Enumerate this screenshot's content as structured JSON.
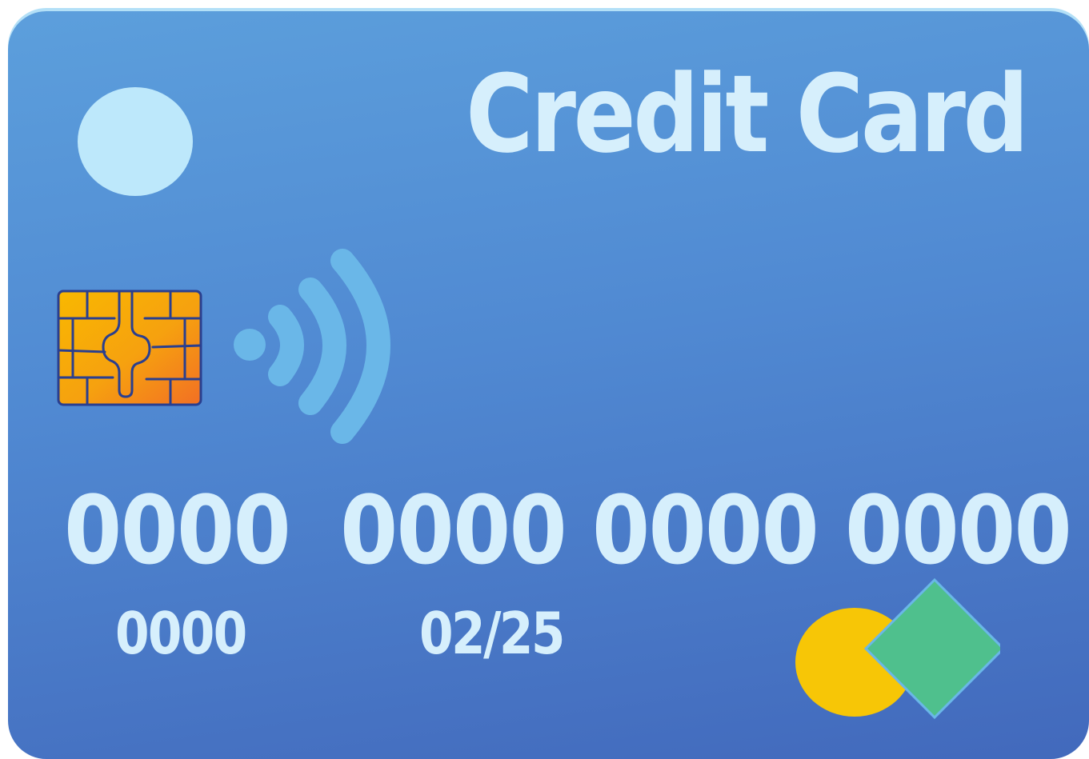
{
  "card": {
    "title": "Credit Card",
    "number_groups": [
      "0000",
      "0000",
      "0000",
      "0000"
    ],
    "small_code": "0000",
    "expiry": "02/25"
  },
  "colors": {
    "card_top": "#5c9fdc",
    "card_bottom": "#4269bc",
    "text": "#d6effc",
    "logo_dot": "#bde8fb",
    "chip_gold": "#f8b300",
    "chip_orange": "#f57a22",
    "chip_outline": "#2a3f8f",
    "contactless": "#6ab7e8",
    "brand_yellow": "#f7c606",
    "brand_green": "#4fc08d"
  },
  "icons": {
    "chip": "emv-chip-icon",
    "contactless": "contactless-icon",
    "brand": "card-brand-logo"
  }
}
